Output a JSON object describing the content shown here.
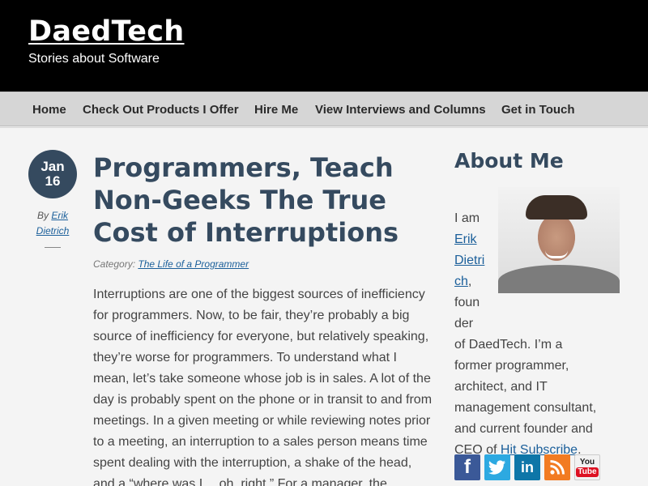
{
  "site": {
    "title": "DaedTech",
    "tagline": "Stories about Software"
  },
  "nav": {
    "items": [
      "Home",
      "Check Out Products I Offer",
      "Hire Me",
      "View Interviews and Columns",
      "Get in Touch"
    ]
  },
  "post": {
    "date_month": "Jan",
    "date_day": "16",
    "by_prefix": "By",
    "author": "Erik Dietrich",
    "title": "Programmers, Teach Non-Geeks The True Cost of Interruptions",
    "category_label": "Category:",
    "category": "The Life of a Programmer",
    "body": "Interruptions are one of the biggest sources of inefficiency for programmers. Now, to be fair, they’re probably a big source of inefficiency for everyone, but relatively speaking, they’re worse for programmers. To understand what I mean, let’s take someone whose job is in sales. A lot of the day is probably spent on the phone or in transit to and from meetings. In a given meeting or while reviewing notes prior to a meeting, an interruption to a sales person means time spent dealing with the interruption, a shake of the head, and a “where was I… oh, right.” For a manager, the"
  },
  "sidebar": {
    "title": "About Me",
    "about_intro": "I am",
    "about_name": "Erik Dietrich",
    "about_comma": ",",
    "about_word": "founder",
    "about_rest": " of DaedTech. I’m a former programmer, architect, and IT management consultant, and current founder and CEO of",
    "about_link": "Hit Subscribe",
    "about_end": ".",
    "social": {
      "facebook_glyph": "f",
      "twitter_glyph": "t",
      "linkedin_glyph": "in",
      "youtube_you": "You",
      "youtube_tube": "Tube"
    }
  },
  "colors": {
    "header_bg": "#000000",
    "nav_bg": "#d6d6d6",
    "heading": "#354a5f",
    "link": "#1b5f9a",
    "facebook": "#3b5998",
    "twitter": "#2da9e1",
    "linkedin": "#0e76a8",
    "rss": "#f27b22"
  },
  "icons": [
    "facebook-icon",
    "twitter-icon",
    "linkedin-icon",
    "rss-icon",
    "youtube-icon"
  ]
}
